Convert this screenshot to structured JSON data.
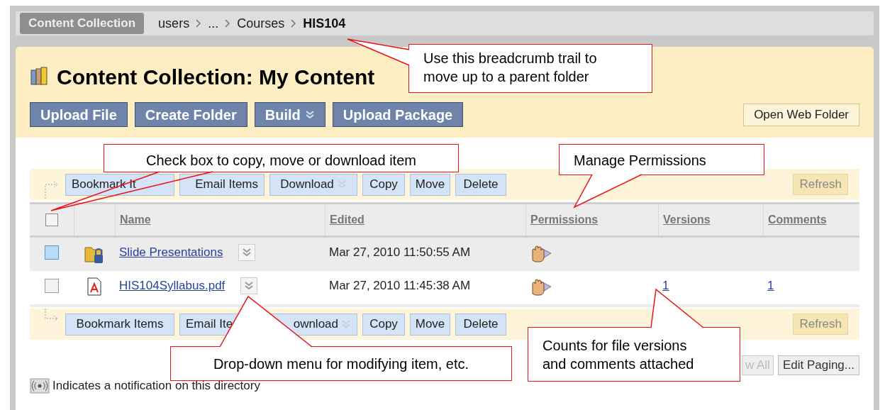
{
  "breadcrumb": {
    "root": "Content Collection",
    "items": [
      {
        "label": "users",
        "current": false
      },
      {
        "label": "...",
        "current": false
      },
      {
        "label": "Courses",
        "current": false
      },
      {
        "label": "HIS104",
        "current": true
      }
    ]
  },
  "header": {
    "title": "Content Collection: My Content",
    "actions": [
      {
        "label": "Upload File",
        "dropdown": false
      },
      {
        "label": "Create Folder",
        "dropdown": false
      },
      {
        "label": "Build",
        "dropdown": true
      },
      {
        "label": "Upload Package",
        "dropdown": false
      }
    ],
    "side_action": "Open Web Folder"
  },
  "top_toolbar": {
    "buttons": [
      {
        "label": "Bookmark It"
      },
      {
        "label": "Email Items"
      },
      {
        "label": "Download",
        "dropdown": true
      },
      {
        "label": "Copy"
      },
      {
        "label": "Move"
      },
      {
        "label": "Delete"
      }
    ],
    "refresh": "Refresh"
  },
  "table": {
    "columns": [
      "Name",
      "Edited",
      "Permissions",
      "Versions",
      "Comments"
    ],
    "select_all_checked": false,
    "rows": [
      {
        "kind": "folder",
        "name": "Slide Presentations",
        "edited": "Mar 27, 2010 11:50:55 AM",
        "highlighted": true,
        "checked": false
      },
      {
        "kind": "pdf",
        "name": "HIS104Syllabus.pdf",
        "edited": "Mar 27, 2010 11:45:38 AM",
        "versions": "1",
        "comments": "1",
        "highlighted": false,
        "checked": false
      }
    ]
  },
  "bottom_toolbar": {
    "buttons": [
      {
        "label": "Bookmark Items"
      },
      {
        "label": "Email Ite"
      },
      {
        "label": "ownload",
        "dropdown": true
      },
      {
        "label": "Copy"
      },
      {
        "label": "Move"
      },
      {
        "label": "Delete"
      }
    ],
    "refresh": "Refresh"
  },
  "paging": {
    "show_all": "w All",
    "edit_paging": "Edit Paging..."
  },
  "legend": "Indicates a notification on this directory",
  "callouts": [
    {
      "text": "Use this breadcrumb trail to move up to a parent folder"
    },
    {
      "text": "Check box to copy, move or download item"
    },
    {
      "text": "Manage Permissions"
    },
    {
      "text": "Drop-down menu for modifying item, etc."
    },
    {
      "text": "Counts for file versions and comments attached"
    }
  ]
}
